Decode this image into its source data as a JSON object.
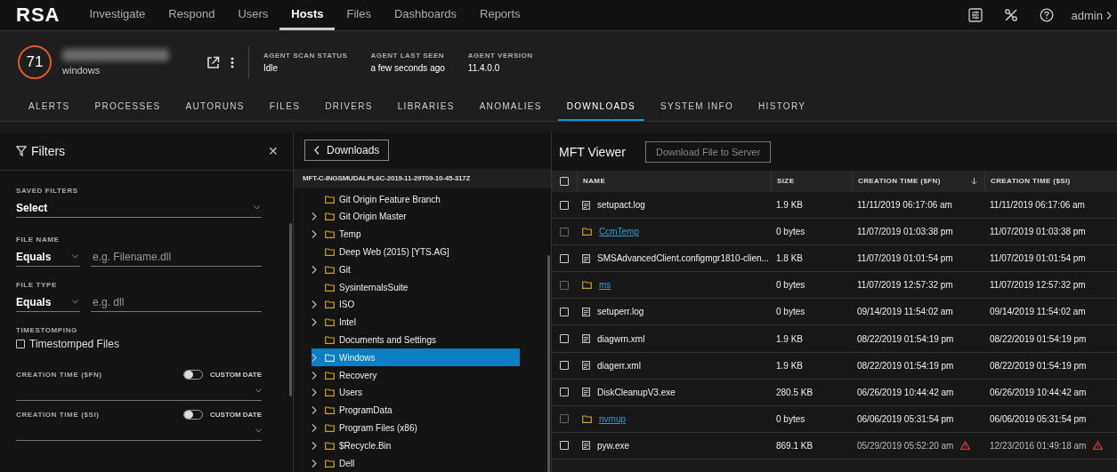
{
  "nav": {
    "logo": "RSA",
    "items": [
      {
        "label": "Investigate",
        "selected": false
      },
      {
        "label": "Respond",
        "selected": false
      },
      {
        "label": "Users",
        "selected": false
      },
      {
        "label": "Hosts",
        "selected": true
      },
      {
        "label": "Files",
        "selected": false
      },
      {
        "label": "Dashboards",
        "selected": false
      },
      {
        "label": "Reports",
        "selected": false
      }
    ],
    "user": "admin"
  },
  "host": {
    "risk_score": "71",
    "os": "windows",
    "stats": [
      {
        "label": "AGENT SCAN STATUS",
        "value": "Idle"
      },
      {
        "label": "AGENT LAST SEEN",
        "value": "a few seconds ago"
      },
      {
        "label": "AGENT VERSION",
        "value": "11.4.0.0"
      }
    ]
  },
  "tabs": [
    {
      "label": "ALERTS",
      "selected": false
    },
    {
      "label": "PROCESSES",
      "selected": false
    },
    {
      "label": "AUTORUNS",
      "selected": false
    },
    {
      "label": "FILES",
      "selected": false
    },
    {
      "label": "DRIVERS",
      "selected": false
    },
    {
      "label": "LIBRARIES",
      "selected": false
    },
    {
      "label": "ANOMALIES",
      "selected": false
    },
    {
      "label": "DOWNLOADS",
      "selected": true
    },
    {
      "label": "SYSTEM INFO",
      "selected": false
    },
    {
      "label": "HISTORY",
      "selected": false
    }
  ],
  "filters": {
    "title": "Filters",
    "close": "✕",
    "saved_filters": {
      "label": "SAVED FILTERS",
      "value": "Select"
    },
    "file_name": {
      "label": "FILE NAME",
      "operator": "Equals",
      "placeholder": "e.g. Filename.dll"
    },
    "file_type": {
      "label": "FILE TYPE",
      "operator": "Equals",
      "placeholder": "e.g. dll"
    },
    "timestomping": {
      "label": "TIMESTOMPING",
      "option": "Timestomped Files",
      "checked": false
    },
    "time_filters": [
      {
        "label": "CREATION TIME ($FN)",
        "toggle_label": "CUSTOM DATE",
        "on": false
      },
      {
        "label": "CREATION TIME ($SI)",
        "toggle_label": "CUSTOM DATE",
        "on": false
      }
    ]
  },
  "tree": {
    "back_button": "Downloads",
    "root": "MFT-C-INGSMUDALPL6C-2019-11-29T09-10-45-317Z",
    "items": [
      {
        "name": "Git Origin Feature Branch",
        "expandable": false,
        "selected": false
      },
      {
        "name": "Git Origin Master",
        "expandable": true,
        "selected": false
      },
      {
        "name": "Temp",
        "expandable": true,
        "selected": false
      },
      {
        "name": "Deep Web (2015) [YTS.AG]",
        "expandable": false,
        "selected": false
      },
      {
        "name": "Git",
        "expandable": true,
        "selected": false
      },
      {
        "name": "SysinternalsSuite",
        "expandable": false,
        "selected": false
      },
      {
        "name": "ISO",
        "expandable": true,
        "selected": false
      },
      {
        "name": "Intel",
        "expandable": true,
        "selected": false
      },
      {
        "name": "Documents and Settings",
        "expandable": false,
        "selected": false
      },
      {
        "name": "Windows",
        "expandable": true,
        "selected": true
      },
      {
        "name": "Recovery",
        "expandable": true,
        "selected": false
      },
      {
        "name": "Users",
        "expandable": true,
        "selected": false
      },
      {
        "name": "ProgramData",
        "expandable": true,
        "selected": false
      },
      {
        "name": "Program Files (x86)",
        "expandable": true,
        "selected": false
      },
      {
        "name": "$Recycle.Bin",
        "expandable": true,
        "selected": false
      },
      {
        "name": "Dell",
        "expandable": true,
        "selected": false
      }
    ]
  },
  "viewer": {
    "title": "MFT Viewer",
    "download_button": "Download File to Server",
    "select_all_checked": false,
    "columns": [
      "NAME",
      "SIZE",
      "CREATION TIME ($FN)",
      "CREATION TIME ($SI)"
    ],
    "rows": [
      {
        "kind": "file",
        "checked": false,
        "name": "setupact.log",
        "size": "1.9 KB",
        "fn_time": "11/11/2019 06:17:06 am",
        "si_time": "11/11/2019 06:17:06 am",
        "fn_warning": false,
        "si_warning": false
      },
      {
        "kind": "folder",
        "checked": false,
        "name": "CcmTemp",
        "size": "0 bytes",
        "fn_time": "11/07/2019 01:03:38 pm",
        "si_time": "11/07/2019 01:03:38 pm",
        "fn_warning": false,
        "si_warning": false
      },
      {
        "kind": "file",
        "checked": false,
        "name": "SMSAdvancedClient.configmgr1810-clien...",
        "size": "1.8 KB",
        "fn_time": "11/07/2019 01:01:54 pm",
        "si_time": "11/07/2019 01:01:54 pm",
        "fn_warning": false,
        "si_warning": false
      },
      {
        "kind": "folder",
        "checked": false,
        "name": "ms",
        "size": "0 bytes",
        "fn_time": "11/07/2019 12:57:32 pm",
        "si_time": "11/07/2019 12:57:32 pm",
        "fn_warning": false,
        "si_warning": false
      },
      {
        "kind": "file",
        "checked": false,
        "name": "setuperr.log",
        "size": "0 bytes",
        "fn_time": "09/14/2019 11:54:02 am",
        "si_time": "09/14/2019 11:54:02 am",
        "fn_warning": false,
        "si_warning": false
      },
      {
        "kind": "file",
        "checked": false,
        "name": "diagwrn.xml",
        "size": "1.9 KB",
        "fn_time": "08/22/2019 01:54:19 pm",
        "si_time": "08/22/2019 01:54:19 pm",
        "fn_warning": false,
        "si_warning": false
      },
      {
        "kind": "file",
        "checked": false,
        "name": "diagerr.xml",
        "size": "1.9 KB",
        "fn_time": "08/22/2019 01:54:19 pm",
        "si_time": "08/22/2019 01:54:19 pm",
        "fn_warning": false,
        "si_warning": false
      },
      {
        "kind": "file",
        "checked": false,
        "name": "DiskCleanupV3.exe",
        "size": "280.5 KB",
        "fn_time": "06/26/2019 10:44:42 am",
        "si_time": "06/26/2019 10:44:42 am",
        "fn_warning": false,
        "si_warning": false
      },
      {
        "kind": "folder",
        "checked": false,
        "name": "nvmup",
        "size": "0 bytes",
        "fn_time": "06/06/2019 05:31:54 pm",
        "si_time": "06/06/2019 05:31:54 pm",
        "fn_warning": false,
        "si_warning": false
      },
      {
        "kind": "file",
        "checked": false,
        "name": "pyw.exe",
        "size": "869.1 KB",
        "fn_time": "05/29/2019 05:52:20 am",
        "si_time": "12/23/2016 01:49:18 am",
        "fn_warning": true,
        "si_warning": true
      }
    ]
  }
}
